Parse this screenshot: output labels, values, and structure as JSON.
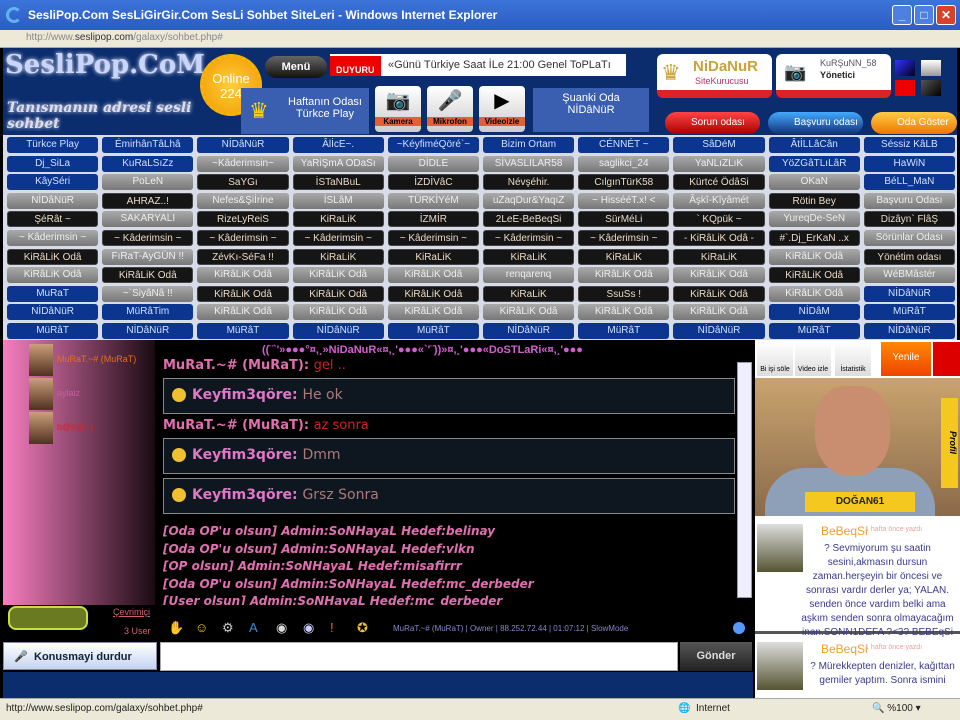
{
  "window": {
    "title": "SesliPop.Com SesLiGirGir.Com SesLi Sohbet SiteLeri - Windows Internet Explorer",
    "url_domain": "seslipop.com",
    "url_prefix": "http://www.",
    "url_path": "/galaxy/sohbet.php#"
  },
  "header": {
    "logo": "SesliPop.CoM",
    "logo_sub": "Tanısmanın adresi sesli sohbet",
    "online_label": "Online",
    "online_count": "224",
    "menu": "Menü",
    "duyuru_tag": "DUYURU",
    "duyuru_text": "«Günü Türkiye Saat İLe 21:00 Genel ToPLaTı",
    "haftanin_title": "Haftanın Odası",
    "haftanin_room": "Türkce Play",
    "media": [
      "Kamera",
      "Mikrofon",
      "Videoizle"
    ],
    "current_label": "Şuanki Oda",
    "current_room": "NİDâNüR",
    "founder_name": "NiDaNuR",
    "founder_role": "SiteKurucusu",
    "admin_name": "KuRŞuNN_58",
    "admin_role": "Yönetici",
    "pills": [
      "Sorun odası",
      "Başvuru odası",
      "Oda Göster"
    ],
    "colors": {
      "blue": "#0c3590",
      "red": "#e00000"
    }
  },
  "rooms": [
    [
      [
        "Türkce Play",
        "b"
      ],
      [
        "ÉmirhânTâLhâ",
        "b"
      ],
      [
        "NİDâNüR",
        "b"
      ],
      [
        "ÂlİcE~.",
        "b"
      ],
      [
        "~KéyfiméQöré`~",
        "b"
      ],
      [
        "Bizim Ortam",
        "b"
      ],
      [
        "CÉNNÉT ~",
        "b"
      ],
      [
        "SâDéM",
        "b"
      ],
      [
        "ÂtİLLâCân",
        "b"
      ],
      [
        "Séssiz KâLB",
        "b"
      ]
    ],
    [
      [
        "Dj_SiLa",
        "b"
      ],
      [
        "KuRaLSıZz",
        "b"
      ],
      [
        "~Kâderimsin~",
        "g"
      ],
      [
        "YaRiŞmA ODaSı",
        "g"
      ],
      [
        "DİDLE",
        "g"
      ],
      [
        "SİVASLILAR58",
        "g"
      ],
      [
        "saglikci_24",
        "g"
      ],
      [
        "YaNLıZLıK",
        "g"
      ],
      [
        "YöZGâTLıLâR",
        "b"
      ],
      [
        "HaWiN",
        "b"
      ]
    ],
    [
      [
        "KâySéri",
        "b"
      ],
      [
        "PoLeN",
        "g"
      ],
      [
        "SaYGı",
        "d"
      ],
      [
        "İSTaNBuL",
        "d"
      ],
      [
        "İZDİVâC",
        "d"
      ],
      [
        "Névşéhir.",
        "d"
      ],
      [
        "CılgınTürK58",
        "d"
      ],
      [
        "Kürtcé ÖdâSi",
        "d"
      ],
      [
        "OKaN",
        "g"
      ],
      [
        "BéLL_MaN",
        "b"
      ]
    ],
    [
      [
        "NİDâNüR",
        "g"
      ],
      [
        "AHRAZ..!",
        "d"
      ],
      [
        "Nefes&Şiİrine",
        "g"
      ],
      [
        "İSLâM",
        "g"
      ],
      [
        "TÜRKİYéM",
        "g"
      ],
      [
        "uZaqDur&YaqıZ",
        "g"
      ],
      [
        "~ HissééT.x! <",
        "g"
      ],
      [
        "Âşkî-Kîyâmét",
        "g"
      ],
      [
        "Rötin Bey",
        "d"
      ],
      [
        "Başvuru Odası",
        "g"
      ]
    ],
    [
      [
        "ŞéRât ~",
        "d"
      ],
      [
        "SAKARYALI",
        "g"
      ],
      [
        "RizeLyReiS",
        "d"
      ],
      [
        "KiRaLiK",
        "d"
      ],
      [
        "İZMİR",
        "d"
      ],
      [
        "2LeE-BeBeqSi",
        "d"
      ],
      [
        "SürMéLi",
        "d"
      ],
      [
        "` KQpük ~",
        "d"
      ],
      [
        "YureqDe-SeN",
        "g"
      ],
      [
        "Dizâyn` FlâŞ",
        "d"
      ]
    ],
    [
      [
        "~ Kâderimsin ~",
        "g"
      ],
      [
        "~ Kâderimsin ~",
        "d"
      ],
      [
        "~ Kâderimsin ~",
        "d"
      ],
      [
        "~ Kâderimsin ~",
        "d"
      ],
      [
        "~ Kâderimsin ~",
        "d"
      ],
      [
        "~ Kâderimsin ~",
        "d"
      ],
      [
        "~ Kâderimsin ~",
        "d"
      ],
      [
        "- KiRâLiK Odâ -",
        "d"
      ],
      [
        "#`.Dj_ErKaN ..x",
        "d"
      ],
      [
        "Sörünlar Odası",
        "g"
      ]
    ],
    [
      [
        "KiRâLiK Odâ",
        "d"
      ],
      [
        "FıRaT-AyGÜN !!",
        "g"
      ],
      [
        "ZévKı-SéFa !!",
        "d"
      ],
      [
        "KiRaLiK",
        "d"
      ],
      [
        "KiRaLiK",
        "d"
      ],
      [
        "KiRaLiK",
        "d"
      ],
      [
        "KiRaLiK",
        "d"
      ],
      [
        "KiRaLiK",
        "d"
      ],
      [
        "KiRâLiK Odâ",
        "g"
      ],
      [
        "Yönétim odası",
        "d"
      ]
    ],
    [
      [
        "KiRâLiK Odâ",
        "g"
      ],
      [
        "KiRâLiK Odâ",
        "d"
      ],
      [
        "KiRâLiK Odâ",
        "g"
      ],
      [
        "KiRâLiK Odâ",
        "g"
      ],
      [
        "KiRâLiK Odâ",
        "g"
      ],
      [
        "renqarenq",
        "g"
      ],
      [
        "KiRâLiK Odâ",
        "g"
      ],
      [
        "KiRâLiK Odâ",
        "g"
      ],
      [
        "KiRâLiK Odâ",
        "d"
      ],
      [
        "WéBMâstér",
        "g"
      ]
    ],
    [
      [
        "MuRaT",
        "b"
      ],
      [
        "~`SiyâNâ !!",
        "g"
      ],
      [
        "KiRâLiK Odâ",
        "d"
      ],
      [
        "KiRâLiK Odâ",
        "d"
      ],
      [
        "KiRâLiK Odâ",
        "d"
      ],
      [
        "KiRaLiK",
        "d"
      ],
      [
        "SsuSs !",
        "d"
      ],
      [
        "KiRâLiK Odâ",
        "d"
      ],
      [
        "KiRâLiK Odâ",
        "g"
      ],
      [
        "NİDâNüR",
        "b"
      ]
    ],
    [
      [
        "NİDâNüR",
        "b"
      ],
      [
        "MüRâTim",
        "b"
      ],
      [
        "KiRâLiK Odâ",
        "g"
      ],
      [
        "KiRâLiK Odâ",
        "g"
      ],
      [
        "KiRâLiK Odâ",
        "g"
      ],
      [
        "KiRâLiK Odâ",
        "g"
      ],
      [
        "KiRâLiK Odâ",
        "g"
      ],
      [
        "KiRâLiK Odâ",
        "g"
      ],
      [
        "NİDâM",
        "b"
      ],
      [
        "MüRâT",
        "b"
      ]
    ],
    [
      [
        "MüRâT",
        "b"
      ],
      [
        "NİDâNüR",
        "b"
      ],
      [
        "MüRâT",
        "b"
      ],
      [
        "NİDâNüR",
        "b"
      ],
      [
        "MüRâT",
        "b"
      ],
      [
        "NİDâNüR",
        "b"
      ],
      [
        "MüRâT",
        "b"
      ],
      [
        "NİDâNüR",
        "b"
      ],
      [
        "MüRâT",
        "b"
      ],
      [
        "NİDâNüR",
        "b"
      ]
    ]
  ],
  "users": [
    {
      "name": "MuRaT.~# (MuRaT)",
      "color": "#e07020"
    },
    {
      "name": "aylaiz",
      "color": "#c060a0"
    },
    {
      "name": "b@b@ :)",
      "color": "#e02020"
    }
  ],
  "userlist_footer": {
    "link": "Çevrimiçi",
    "count": "3 User"
  },
  "chat": {
    "topic": "((¨`'»●●●°¤,¸»NiDaNuR«¤,¸'●●●«`'¨))»¤,¸'●●●«DoSTLaRi«¤,¸'●●●",
    "lines": [
      {
        "type": "line",
        "nick": "MuRaT.~# (MuRaT):",
        "text": "gel .."
      },
      {
        "type": "box",
        "nick": "Keyfim3qöre:",
        "text": "He ok"
      },
      {
        "type": "line",
        "nick": "MuRaT.~# (MuRaT):",
        "text": "az sonra"
      },
      {
        "type": "box",
        "nick": "Keyfim3qöre:",
        "text": "Dmm"
      },
      {
        "type": "box",
        "nick": "Keyfim3qöre:",
        "text": "Grsz Sonra"
      }
    ],
    "system": [
      "[Oda OP'u olsun] Admin:SoNHayaL Hedef:belinay",
      "[Oda OP'u olsun] Admin:SoNHayaL Hedef:vlkn",
      "[OP olsun] Admin:SoNHayaL Hedef:misafirrr",
      "[Oda OP'u olsun] Admin:SoNHayaL Hedef:mc_derbeder",
      "[User olsun] Admin:SoNHayaL Hedef:mc_derbeder"
    ],
    "info": "MuRaT.~# (MuRaT) | Owner | 88.252.72.44 | 01:07:12 | SlowMode"
  },
  "input": {
    "stop_label": "Konusmayi durdur",
    "send_label": "Gönder",
    "placeholder": ""
  },
  "right": {
    "tabs": [
      "Bi işi söle",
      "Video izle",
      "İstatistik",
      "Yenile"
    ],
    "cam_name": "DOĞAN61",
    "profile_tab": "Profil",
    "posts": [
      {
        "author": "BeBeqSi",
        "time": "1 hafta önce yazdı",
        "text": "? Sevmiyorum şu saatin sesini,akmasın dursun zaman.herşeyin bir öncesi ve sonrası vardır derler ya; YALAN. senden önce vardım belki ama aşkım senden sonra olmayacağım inan.SONN1DEFA ?<3? BEBEqSi"
      },
      {
        "author": "BeBeqSi",
        "time": "1 hafta önce yazdı",
        "text": "? Mürekkepten denizler, kağıttan gemiler yaptım. Sonra ismini"
      }
    ]
  },
  "status": {
    "url": "http://www.seslipop.com/galaxy/sohbet.php#",
    "zone": "Internet",
    "zoom": "%100"
  }
}
